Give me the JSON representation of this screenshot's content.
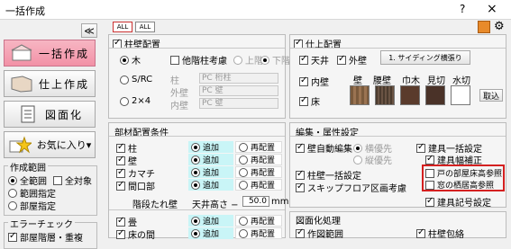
{
  "window": {
    "title": "一括作成",
    "help": "?",
    "close": "×"
  },
  "left": {
    "collapse": "≪",
    "buttons": [
      "一括作成",
      "仕上作成",
      "図面化",
      "お気に入り▾"
    ],
    "range": {
      "title": "作成範囲",
      "options": [
        "全範囲",
        "範囲指定",
        "部屋指定"
      ],
      "target": "全対象"
    },
    "error": {
      "title": "エラーチェック",
      "item": "部屋階層・重複"
    }
  },
  "toolbar": {
    "all_on": "ALL",
    "all_off": "ALL"
  },
  "column_section": {
    "title": "柱壁配置",
    "other_floor": "他階柱考慮",
    "upper": "上階",
    "lower": "下階",
    "options": [
      "木",
      "S/RC",
      "2×4"
    ],
    "labels": [
      "柱",
      "外壁",
      "内壁"
    ],
    "values": [
      "PC 桁柱",
      "PC 壁",
      "PC 壁"
    ]
  },
  "finish_section": {
    "title": "仕上配置",
    "ceiling": "天井",
    "outer_wall": "外壁",
    "outer_button": "1. サイディング横張り",
    "inner_wall": "内壁",
    "floor": "床",
    "material_labels": [
      "壁",
      "腰壁",
      "巾木",
      "見切",
      "水切"
    ],
    "import": "取込"
  },
  "parts_section": {
    "title": "部材配置条件",
    "items": [
      "柱",
      "壁",
      "カマチ",
      "間口部"
    ],
    "add": "追加",
    "re": "再配置",
    "ridge": "階段たれ壁",
    "ceiling_height": "天井高さ −",
    "mm_value": "50.0",
    "mm": "mm",
    "items2": [
      "畳",
      "床の間"
    ]
  },
  "edit_section": {
    "title": "編集・属性設定",
    "wall_auto": "壁自動編集",
    "h_first": "横優先",
    "v_first": "縦優先",
    "col_wall": "柱壁一括設定",
    "skip_floor": "スキップフロア区画考慮",
    "fitting": "建具一括設定",
    "fitting_width": "建具幅補正",
    "door": "戸の部屋床高参照",
    "window": "窓の栖居高参照",
    "fitting_no": "建具記号設定"
  },
  "drawing_section": {
    "title": "図面化処理",
    "range": "作図範囲",
    "outline": "柱壁包絡"
  }
}
